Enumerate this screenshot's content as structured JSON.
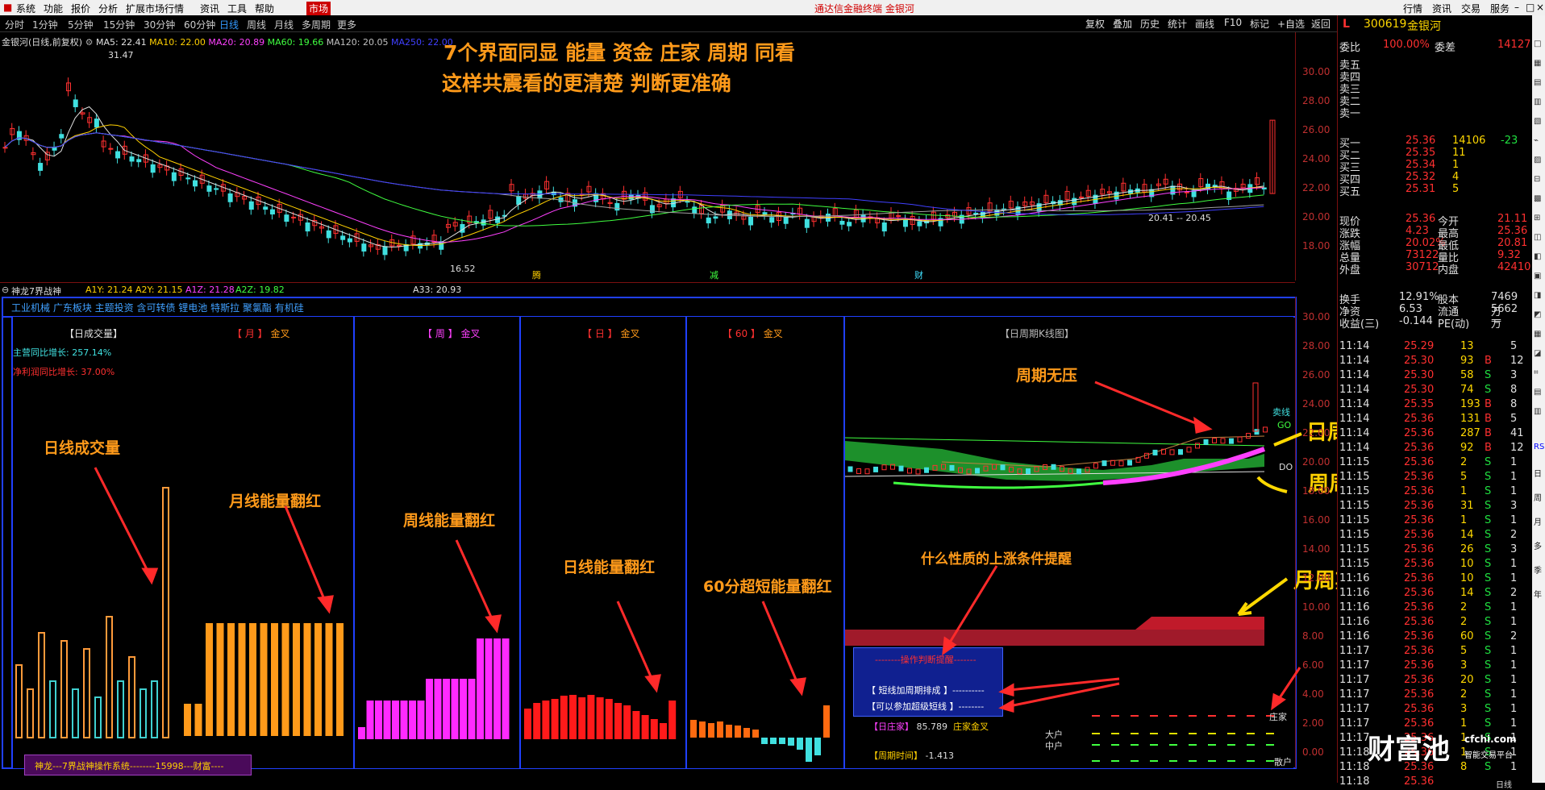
{
  "menubar": {
    "items": [
      "系统",
      "功能",
      "报价",
      "分析",
      "扩展市场行情",
      "资讯",
      "工具",
      "帮助"
    ],
    "market": "市场",
    "title": "通达信金融终端 金银河",
    "right": [
      "行情",
      "资讯",
      "交易",
      "服务"
    ]
  },
  "toolbar": {
    "periods": [
      "分时",
      "1分钟",
      "5分钟",
      "15分钟",
      "30分钟",
      "60分钟",
      "日线",
      "周线",
      "月线",
      "多周期",
      "更多"
    ],
    "selected": "日线",
    "right_tools": [
      "复权",
      "叠加",
      "历史",
      "统计",
      "画线",
      "F10",
      "标记",
      "+自选",
      "返回"
    ]
  },
  "main_chart": {
    "title": "金银河(日线,前复权)",
    "ma": [
      {
        "label": "MA5: 22.41",
        "color": "#e0e0e0"
      },
      {
        "label": "MA10: 22.00",
        "color": "#ffd000"
      },
      {
        "label": "MA20: 20.89",
        "color": "#ff40ff"
      },
      {
        "label": "MA60: 19.66",
        "color": "#40ff40"
      },
      {
        "label": "MA120: 20.05",
        "color": "#c0c0c0"
      },
      {
        "label": "MA250: 22.00",
        "color": "#4040ff"
      }
    ],
    "high_label": "31.47",
    "low_label": "16.52",
    "mid_label": "20.41 -- 20.45",
    "price_ticks": [
      "30.00",
      "28.00",
      "26.00",
      "24.00",
      "22.00",
      "20.00",
      "18.00"
    ],
    "markers": [
      "腾",
      "减",
      "财"
    ],
    "headline1": "7个界面同显   能量    资金     庄家    周期   同看",
    "headline2": "这样共震看的更清楚    判断更准确"
  },
  "indicator_bar": {
    "name": "神龙7界战神",
    "values": [
      {
        "label": "A1Y: 21.24",
        "color": "#ffd000"
      },
      {
        "label": "A2Y: 21.15",
        "color": "#ffd000"
      },
      {
        "label": "A1Z: 21.28",
        "color": "#ff40ff"
      },
      {
        "label": "A2Z: 19.82",
        "color": "#40ff40"
      },
      {
        "label": "A33: 20.93",
        "color": "#e0e0e0"
      }
    ]
  },
  "sector_bar": "工业机械 广东板块 主题投资 含可转债 锂电池 特斯拉 聚氯酯 有机硅",
  "sub_price_ticks": [
    "30.00",
    "28.00",
    "26.00",
    "24.00",
    "22.00",
    "20.00",
    "18.00",
    "16.00",
    "14.00",
    "12.00",
    "10.00",
    "8.00",
    "6.00",
    "4.00",
    "2.00",
    "0.00"
  ],
  "subpanels": {
    "volume": {
      "title": "【日成交量】",
      "line1": "主营同比增长: 257.14%",
      "line2": "净利润同比增长: 37.00%",
      "anno": "日线成交量",
      "bars": [
        {
          "h": 90,
          "c": "#ff9a3a"
        },
        {
          "h": 60,
          "c": "#ff9a3a"
        },
        {
          "h": 130,
          "c": "#ff9a3a"
        },
        {
          "h": 70,
          "c": "#40d0d0"
        },
        {
          "h": 120,
          "c": "#ff9a3a"
        },
        {
          "h": 60,
          "c": "#40d0d0"
        },
        {
          "h": 110,
          "c": "#ff9a3a"
        },
        {
          "h": 50,
          "c": "#40d0d0"
        },
        {
          "h": 150,
          "c": "#ff9a3a"
        },
        {
          "h": 70,
          "c": "#40d0d0"
        },
        {
          "h": 100,
          "c": "#ff9a3a"
        },
        {
          "h": 60,
          "c": "#40d0d0"
        },
        {
          "h": 70,
          "c": "#40d0d0"
        },
        {
          "h": 310,
          "c": "#ff9a3a"
        }
      ]
    },
    "month": {
      "title_tag": "【 月 】",
      "title": "金叉",
      "anno": "月线能量翻红",
      "bars": [
        40,
        40,
        140,
        140,
        140,
        140,
        140,
        140,
        140,
        140,
        140,
        140,
        140,
        140,
        140
      ]
    },
    "week": {
      "title_tag": "【 周 】",
      "title": "金叉",
      "anno": "周线能量翻红",
      "bars": [
        15,
        48,
        48,
        48,
        48,
        48,
        48,
        48,
        75,
        75,
        75,
        75,
        75,
        75,
        125,
        125,
        125,
        125
      ]
    },
    "day": {
      "title_tag": "【 日 】",
      "title": "金叉",
      "anno": "日线能量翻红",
      "bars": [
        38,
        45,
        48,
        50,
        54,
        55,
        52,
        55,
        52,
        50,
        45,
        42,
        35,
        30,
        25,
        20,
        48
      ]
    },
    "m60": {
      "title_tag": "【 60 】",
      "title": "金叉",
      "anno": "60分超短能量翻红",
      "bars": [
        22,
        20,
        18,
        20,
        16,
        15,
        12,
        10,
        -8,
        -8,
        -8,
        -10,
        -15,
        -30,
        -22,
        40
      ]
    },
    "cycle": {
      "title": "【日周期K线图】",
      "anno1": "周期无压",
      "anno2": "什么性质的上涨条件提醒",
      "box_title": "--------操作判断提醒-------",
      "box_line1": "【 短线加周期排成 】----------",
      "box_line2": "【可以参加超级短线 】--------",
      "zj_label": "【日庄家】",
      "zj_value": "85.789",
      "zj_text": "庄家金叉",
      "zq_label": "【周期时间】",
      "zq_value": "-1.413",
      "mai": "卖线",
      "go": "GO",
      "do": "DO",
      "zhuang": "庄家",
      "dahu": "大户",
      "zhonghu": "中户",
      "sanhu": "散户"
    }
  },
  "yellow_labels": [
    "日周期",
    "周周期",
    "月周期"
  ],
  "footer_note": "神龙---7界战神操作系统--------15998---财富----",
  "right_panel": {
    "code": "300619",
    "name": "金银河",
    "weibi_label": "委比",
    "weibi": "100.00%",
    "weicha_label": "委差",
    "weicha": "14127",
    "sell": [
      {
        "l": "卖五"
      },
      {
        "l": "卖四"
      },
      {
        "l": "卖三"
      },
      {
        "l": "卖二"
      },
      {
        "l": "卖一"
      }
    ],
    "buy": [
      {
        "l": "买一",
        "p": "25.36",
        "v": "14106",
        "c": "-23"
      },
      {
        "l": "买二",
        "p": "25.35",
        "v": "11",
        "c": ""
      },
      {
        "l": "买三",
        "p": "25.34",
        "v": "1",
        "c": ""
      },
      {
        "l": "买四",
        "p": "25.32",
        "v": "4",
        "c": ""
      },
      {
        "l": "买五",
        "p": "25.31",
        "v": "5",
        "c": ""
      }
    ],
    "quote": [
      {
        "a": "现价",
        "av": "25.36",
        "b": "今开",
        "bv": "21.11"
      },
      {
        "a": "涨跌",
        "av": "4.23",
        "b": "最高",
        "bv": "25.36"
      },
      {
        "a": "涨幅",
        "av": "20.02%",
        "b": "最低",
        "bv": "20.81"
      },
      {
        "a": "总量",
        "av": "73122",
        "b": "量比",
        "bv": "9.32"
      },
      {
        "a": "外盘",
        "av": "30712",
        "b": "内盘",
        "bv": "42410"
      }
    ],
    "fin": [
      {
        "a": "换手",
        "av": "12.91%",
        "b": "股本",
        "bv": "7469万"
      },
      {
        "a": "净资",
        "av": "6.53",
        "b": "流通",
        "bv": "5662万"
      },
      {
        "a": "收益(三)",
        "av": "-0.144",
        "b": "PE(动)",
        "bv": "—"
      }
    ],
    "ticks": [
      {
        "t": "11:14",
        "p": "25.29",
        "v": "13",
        "s": "",
        "n": "5"
      },
      {
        "t": "11:14",
        "p": "25.30",
        "v": "93",
        "s": "B",
        "n": "12"
      },
      {
        "t": "11:14",
        "p": "25.30",
        "v": "58",
        "s": "S",
        "n": "3"
      },
      {
        "t": "11:14",
        "p": "25.30",
        "v": "74",
        "s": "S",
        "n": "8"
      },
      {
        "t": "11:14",
        "p": "25.35",
        "v": "193",
        "s": "B",
        "n": "8"
      },
      {
        "t": "11:14",
        "p": "25.36",
        "v": "131",
        "s": "B",
        "n": "5"
      },
      {
        "t": "11:14",
        "p": "25.36",
        "v": "287",
        "s": "B",
        "n": "41"
      },
      {
        "t": "11:14",
        "p": "25.36",
        "v": "92",
        "s": "B",
        "n": "12"
      },
      {
        "t": "11:15",
        "p": "25.36",
        "v": "2",
        "s": "S",
        "n": "1"
      },
      {
        "t": "11:15",
        "p": "25.36",
        "v": "5",
        "s": "S",
        "n": "1"
      },
      {
        "t": "11:15",
        "p": "25.36",
        "v": "1",
        "s": "S",
        "n": "1"
      },
      {
        "t": "11:15",
        "p": "25.36",
        "v": "31",
        "s": "S",
        "n": "3"
      },
      {
        "t": "11:15",
        "p": "25.36",
        "v": "1",
        "s": "S",
        "n": "1"
      },
      {
        "t": "11:15",
        "p": "25.36",
        "v": "14",
        "s": "S",
        "n": "2"
      },
      {
        "t": "11:15",
        "p": "25.36",
        "v": "26",
        "s": "S",
        "n": "3"
      },
      {
        "t": "11:15",
        "p": "25.36",
        "v": "10",
        "s": "S",
        "n": "1"
      },
      {
        "t": "11:16",
        "p": "25.36",
        "v": "10",
        "s": "S",
        "n": "1"
      },
      {
        "t": "11:16",
        "p": "25.36",
        "v": "14",
        "s": "S",
        "n": "2"
      },
      {
        "t": "11:16",
        "p": "25.36",
        "v": "2",
        "s": "S",
        "n": "1"
      },
      {
        "t": "11:16",
        "p": "25.36",
        "v": "2",
        "s": "S",
        "n": "1"
      },
      {
        "t": "11:16",
        "p": "25.36",
        "v": "60",
        "s": "S",
        "n": "2"
      },
      {
        "t": "11:17",
        "p": "25.36",
        "v": "5",
        "s": "S",
        "n": "1"
      },
      {
        "t": "11:17",
        "p": "25.36",
        "v": "3",
        "s": "S",
        "n": "1"
      },
      {
        "t": "11:17",
        "p": "25.36",
        "v": "20",
        "s": "S",
        "n": "1"
      },
      {
        "t": "11:17",
        "p": "25.36",
        "v": "2",
        "s": "S",
        "n": "1"
      },
      {
        "t": "11:17",
        "p": "25.36",
        "v": "3",
        "s": "S",
        "n": "1"
      },
      {
        "t": "11:17",
        "p": "25.36",
        "v": "1",
        "s": "S",
        "n": "1"
      },
      {
        "t": "11:17",
        "p": "25.36",
        "v": "1",
        "s": "S",
        "n": "1"
      },
      {
        "t": "11:18",
        "p": "25.36",
        "v": "1",
        "s": "S",
        "n": "1"
      },
      {
        "t": "11:18",
        "p": "25.36",
        "v": "8",
        "s": "S",
        "n": "1"
      },
      {
        "t": "11:18",
        "p": "25.36",
        "v": "",
        "s": "",
        "n": ""
      }
    ],
    "ribbon": "日线"
  },
  "watermark": {
    "brand": "财富池",
    "site": "cfchi.com",
    "tag": "智能交易平台"
  },
  "sidebar": [
    "RSI",
    "日",
    "周",
    "月",
    "多",
    "季",
    "年"
  ]
}
